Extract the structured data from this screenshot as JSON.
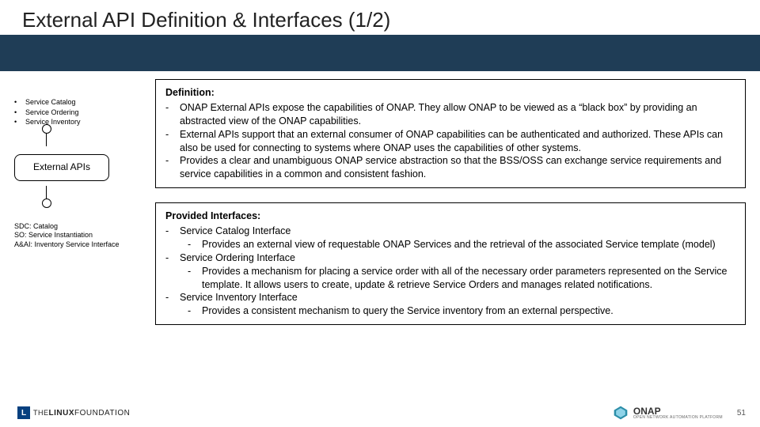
{
  "title": "External API Definition & Interfaces (1/2)",
  "left": {
    "bullets": [
      "Service Catalog",
      "Service Ordering",
      "Service Inventory"
    ],
    "module": "External APIs",
    "lower": [
      "SDC: Catalog",
      "SO: Service Instantiation",
      "A&AI: Inventory Service Interface"
    ]
  },
  "definition": {
    "heading": "Definition:",
    "items": [
      "ONAP External APIs expose the capabilities of ONAP.  They allow ONAP to be viewed as a “black box” by providing an abstracted view of the ONAP capabilities.",
      "External APIs support that an external consumer of ONAP capabilities can be authenticated and authorized. These APIs can also be used for connecting to systems where ONAP uses the capabilities of other systems.",
      "Provides a clear and unambiguous ONAP service abstraction so that the BSS/OSS can exchange service requirements and service capabilities in a common and consistent fashion."
    ]
  },
  "provided": {
    "heading": "Provided Interfaces:",
    "items": [
      {
        "name": "Service Catalog Interface",
        "desc": "Provides an external view of requestable ONAP Services and the retrieval of the associated Service template (model)"
      },
      {
        "name": "Service Ordering Interface",
        "desc": "Provides a mechanism for placing a service order with all of the necessary order parameters represented on the Service template. It allows users to create, update & retrieve Service Orders and manages related notifications."
      },
      {
        "name": "Service Inventory Interface",
        "desc": "Provides a consistent mechanism to query the Service inventory from an external perspective."
      }
    ]
  },
  "footer": {
    "linux_the": "THE",
    "linux_rest": "LINUX",
    "linux_fdn": "FOUNDATION",
    "onap": "ONAP",
    "onap_sub": "OPEN NETWORK AUTOMATION PLATFORM",
    "page": "51"
  }
}
